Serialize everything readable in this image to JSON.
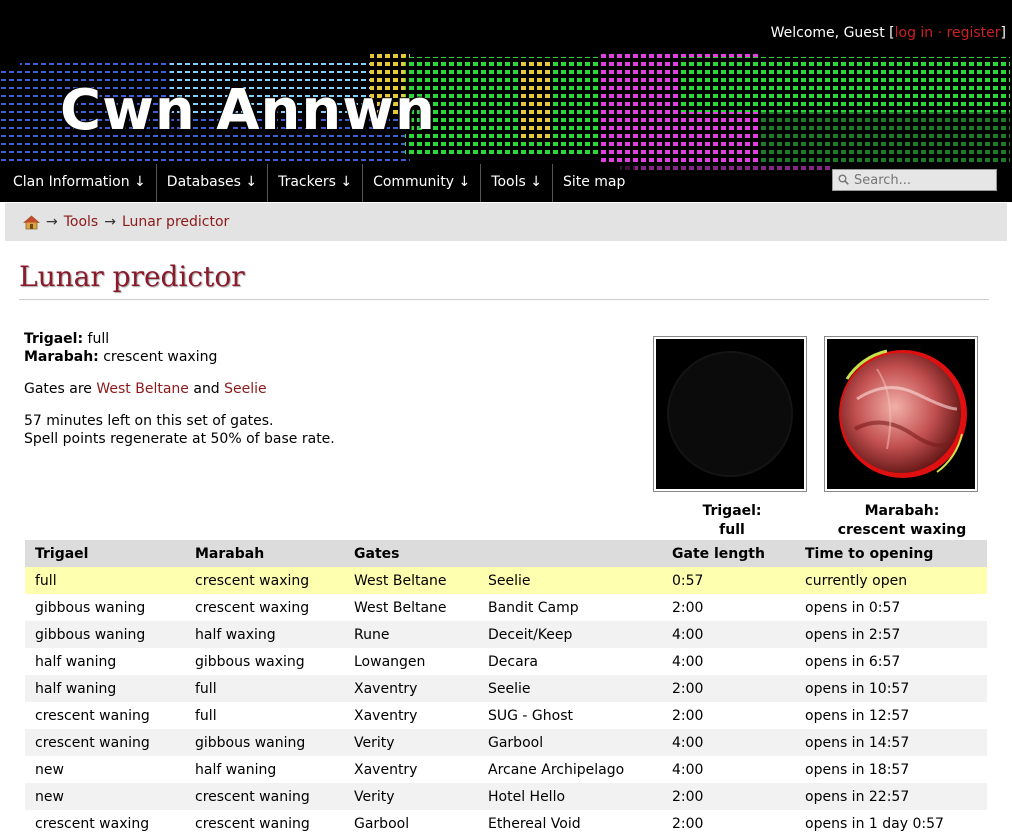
{
  "site": {
    "title": "Cwn Annwn",
    "welcome_text": "Welcome, Guest [",
    "login_label": "log in",
    "separator": "·",
    "register_label": "register",
    "welcome_end": "]"
  },
  "nav": {
    "items": [
      {
        "label": "Clan Information ↓"
      },
      {
        "label": "Databases ↓"
      },
      {
        "label": "Trackers ↓"
      },
      {
        "label": "Community ↓"
      },
      {
        "label": "Tools ↓"
      },
      {
        "label": "Site map"
      }
    ],
    "search_placeholder": "Search..."
  },
  "breadcrumb": {
    "home_icon": "home-icon",
    "arrow": "→",
    "items": [
      "Tools",
      "Lunar predictor"
    ]
  },
  "page": {
    "title": "Lunar predictor",
    "trigael_label": "Trigael:",
    "trigael_phase": "full",
    "marabah_label": "Marabah:",
    "marabah_phase": "crescent waxing",
    "gates_prefix": "Gates are",
    "gate1": "West Beltane",
    "gates_and": "and",
    "gate2": "Seelie",
    "time_left": "57 minutes left on this set of gates.",
    "regen": "Spell points regenerate at 50% of base rate.",
    "moons": [
      {
        "name": "Trigael:",
        "phase": "full"
      },
      {
        "name": "Marabah:",
        "phase": "crescent waxing"
      }
    ]
  },
  "table": {
    "headers": [
      "Trigael",
      "Marabah",
      "Gates",
      "",
      "Gate length",
      "Time to opening"
    ],
    "rows": [
      [
        "full",
        "crescent waxing",
        "West Beltane",
        "Seelie",
        "0:57",
        "currently open"
      ],
      [
        "gibbous waning",
        "crescent waxing",
        "West Beltane",
        "Bandit Camp",
        "2:00",
        "opens in 0:57"
      ],
      [
        "gibbous waning",
        "half waxing",
        "Rune",
        "Deceit/Keep",
        "4:00",
        "opens in 2:57"
      ],
      [
        "half waning",
        "gibbous waxing",
        "Lowangen",
        "Decara",
        "4:00",
        "opens in 6:57"
      ],
      [
        "half waning",
        "full",
        "Xaventry",
        "Seelie",
        "2:00",
        "opens in 10:57"
      ],
      [
        "crescent waning",
        "full",
        "Xaventry",
        "SUG - Ghost",
        "2:00",
        "opens in 12:57"
      ],
      [
        "crescent waning",
        "gibbous waning",
        "Verity",
        "Garbool",
        "4:00",
        "opens in 14:57"
      ],
      [
        "new",
        "half waning",
        "Xaventry",
        "Arcane Archipelago",
        "4:00",
        "opens in 18:57"
      ],
      [
        "new",
        "crescent waning",
        "Verity",
        "Hotel Hello",
        "2:00",
        "opens in 22:57"
      ],
      [
        "crescent waxing",
        "crescent waning",
        "Garbool",
        "Ethereal Void",
        "2:00",
        "opens in 1 day 0:57"
      ]
    ]
  },
  "colors": {
    "link": "#8b1a1a",
    "title": "#8b1a2b",
    "current_row": "#ffffb0",
    "header_bg": "#000000"
  }
}
